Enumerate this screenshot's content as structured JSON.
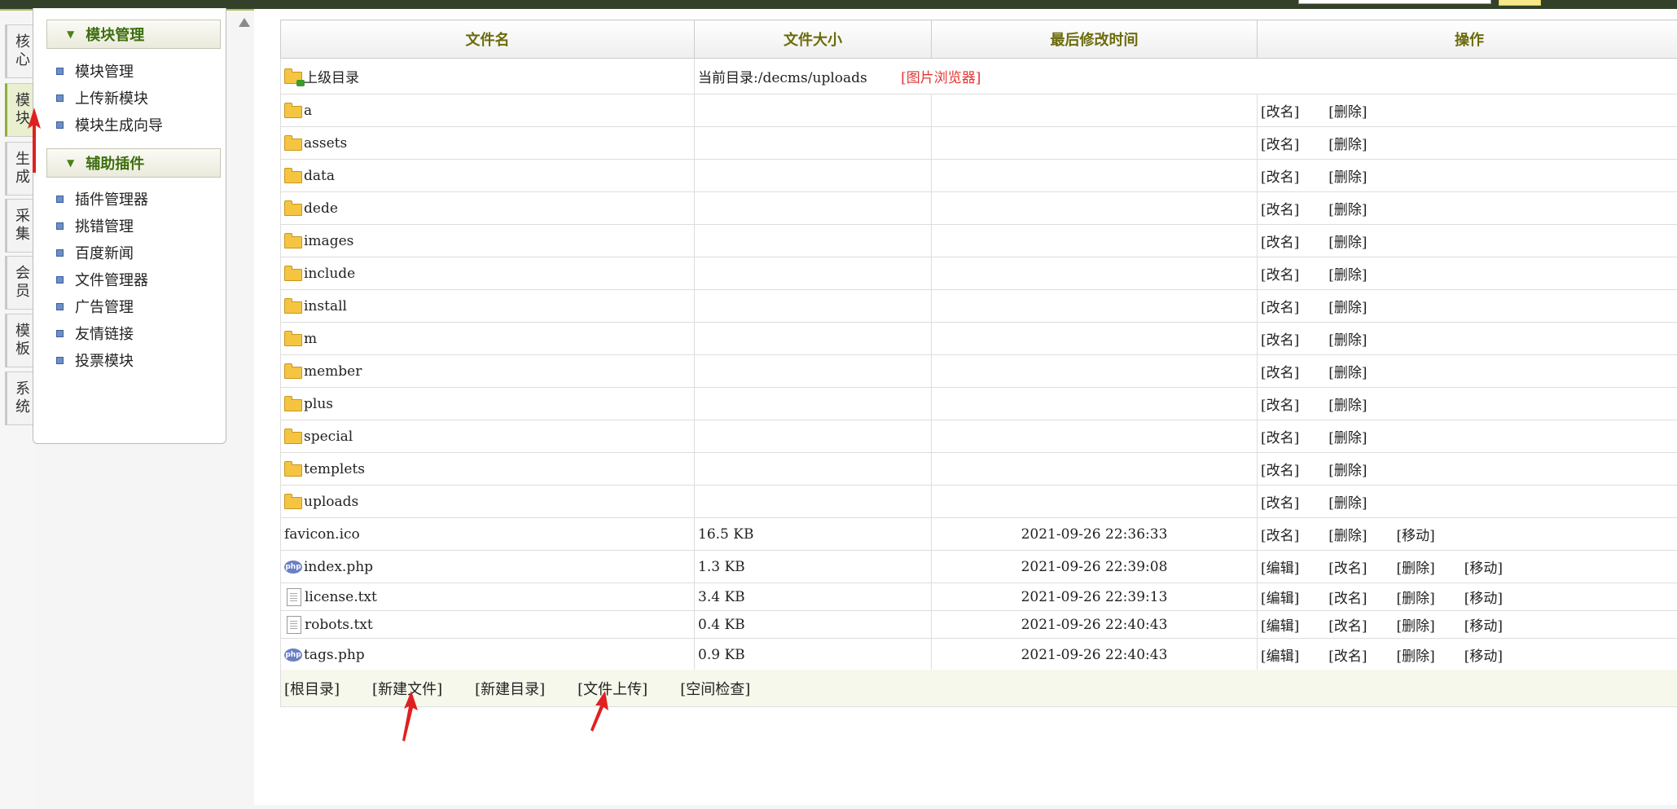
{
  "left_tabs": [
    {
      "label": "核心",
      "active": false
    },
    {
      "label": "模块",
      "active": true
    },
    {
      "label": "生成",
      "active": false
    },
    {
      "label": "采集",
      "active": false
    },
    {
      "label": "会员",
      "active": false
    },
    {
      "label": "模板",
      "active": false
    },
    {
      "label": "系统",
      "active": false
    }
  ],
  "menu": {
    "group1": {
      "title": "模块管理",
      "items": [
        "模块管理",
        "上传新模块",
        "模块生成向导"
      ]
    },
    "group2": {
      "title": "辅助插件",
      "items": [
        "插件管理器",
        "挑错管理",
        "百度新闻",
        "文件管理器",
        "广告管理",
        "友情链接",
        "投票模块"
      ]
    }
  },
  "table": {
    "headers": {
      "name": "文件名",
      "size": "文件大小",
      "mtime": "最后修改时间",
      "ops": "操作"
    },
    "parent_row": {
      "name": "上级目录",
      "current_dir": "当前目录:/decms/uploads",
      "image_browser": "[图片浏览器]"
    },
    "ops": {
      "rename": "[改名]",
      "delete": "[删除]",
      "move": "[移动]",
      "edit": "[编辑]"
    },
    "folders": [
      "a",
      "assets",
      "data",
      "dede",
      "images",
      "include",
      "install",
      "m",
      "member",
      "plus",
      "special",
      "templets",
      "uploads"
    ],
    "files": [
      {
        "name": "favicon.ico",
        "size": "16.5 KB",
        "mtime": "2021-09-26 22:36:33",
        "icon": "none"
      },
      {
        "name": "index.php",
        "size": "1.3 KB",
        "mtime": "2021-09-26 22:39:08",
        "icon": "php-icon"
      },
      {
        "name": "license.txt",
        "size": "3.4 KB",
        "mtime": "2021-09-26 22:39:13",
        "icon": "txt-icon"
      },
      {
        "name": "robots.txt",
        "size": "0.4 KB",
        "mtime": "2021-09-26 22:40:43",
        "icon": "txt-icon"
      },
      {
        "name": "tags.php",
        "size": "0.9 KB",
        "mtime": "2021-09-26 22:40:43",
        "icon": "php-icon"
      }
    ]
  },
  "footer": {
    "root": "[根目录]",
    "new_file": "[新建文件]",
    "new_dir": "[新建目录]",
    "upload": "[文件上传]",
    "space_check": "[空间检查]"
  },
  "colors": {
    "annotation_red": "#e02020",
    "header_text": "#6b6b0c",
    "menu_head_text": "#3e6e0e",
    "link_red": "#e53434"
  }
}
